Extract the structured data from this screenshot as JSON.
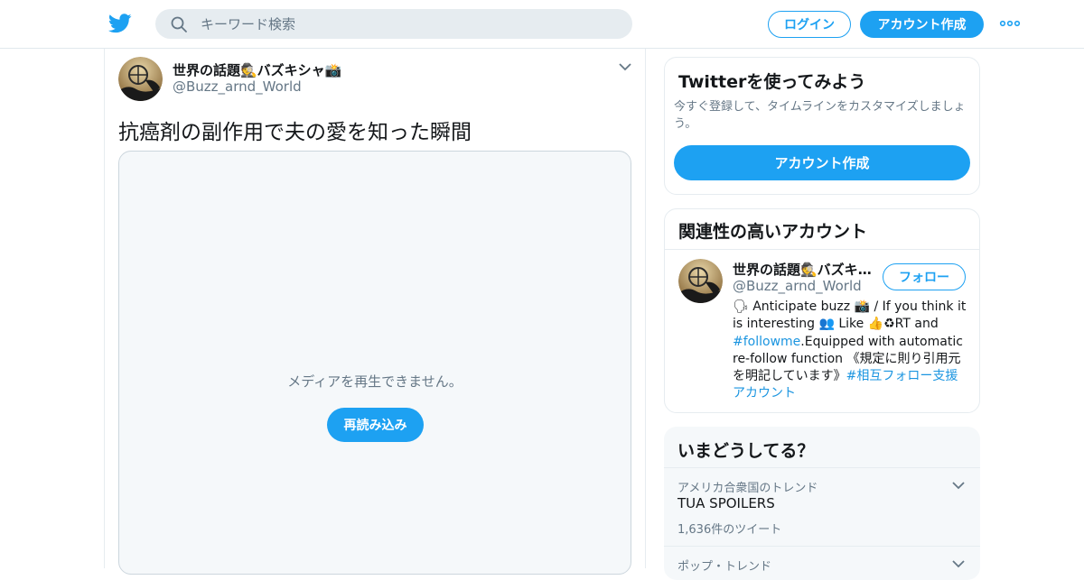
{
  "header": {
    "search_placeholder": "キーワード検索",
    "login_label": "ログイン",
    "signup_label": "アカウント作成"
  },
  "tweet": {
    "author_name": "世界の話題🕵バズキシャ📸",
    "author_handle": "@Buzz_arnd_World",
    "text": "抗癌剤の副作用で夫の愛を知った瞬間",
    "media_message": "メディアを再生できません。",
    "reload_label": "再読み込み"
  },
  "signup_card": {
    "title": "Twitterを使ってみよう",
    "description": "今すぐ登録して、タイムラインをカスタマイズしましょう。",
    "cta_label": "アカウント作成"
  },
  "related": {
    "title": "関連性の高いアカウント",
    "name": "世界の話題🕵バズキシャ📸",
    "handle": "@Buzz_arnd_World",
    "follow_label": "フォロー",
    "bio_part1": "🗣 Anticipate buzz 📸 / If you think it is interesting 👥 Like 👍♻RT and ",
    "bio_tag1": "#followme",
    "bio_part2": ".Equipped with automatic re-follow function 《規定に則り引用元を明記しています》",
    "bio_tag2": "#相互フォロー支援アカウント"
  },
  "trends": {
    "title": "いまどうしてる？",
    "items": [
      {
        "context": "アメリカ合衆国のトレンド",
        "name": "TUA SPOILERS",
        "count": "1,636件のツイート"
      },
      {
        "context": "ポップ・トレンド",
        "name": "",
        "count": ""
      }
    ]
  },
  "colors": {
    "accent": "#1da1f2",
    "link": "#1b95e0",
    "secondary_text": "#657786"
  }
}
